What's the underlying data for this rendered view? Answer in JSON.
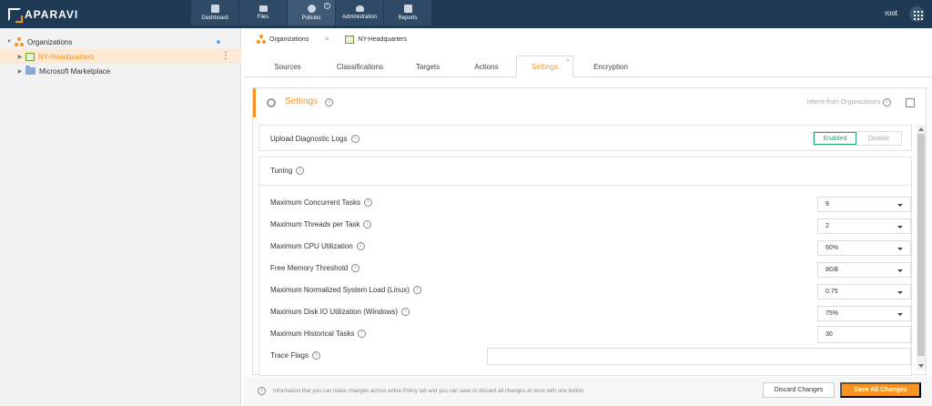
{
  "app": {
    "logo_text": "APARAVI",
    "user": "root"
  },
  "nav": [
    {
      "label": "Dashboard",
      "icon": "dashboard-icon"
    },
    {
      "label": "Files",
      "icon": "folder-icon"
    },
    {
      "label": "Policies",
      "icon": "gear-icon",
      "active": true
    },
    {
      "label": "Administration",
      "icon": "users-icon"
    },
    {
      "label": "Reports",
      "icon": "report-icon"
    }
  ],
  "tree": {
    "root": "Organizations",
    "children": [
      {
        "label": "NY-Headquarters",
        "selected": true
      },
      {
        "label": "Microsoft Marketplace"
      }
    ]
  },
  "breadcrumb": [
    "Organizations",
    "NY-Headquarters"
  ],
  "tabs": [
    "Sources",
    "Classifications",
    "Targets",
    "Actions",
    "Settings",
    "Encryption"
  ],
  "active_tab": "Settings",
  "settings": {
    "title": "Settings",
    "inherit_label": "Inherit from Organizations",
    "upload_logs": {
      "label": "Upload Diagnostic Logs",
      "enabled": "Enabled",
      "disable": "Disable"
    },
    "tuning_label": "Tuning",
    "fields": [
      {
        "label": "Maximum Concurrent Tasks",
        "value": "9"
      },
      {
        "label": "Maximum Threads per Task",
        "value": "2"
      },
      {
        "label": "Maximum CPU Utilization",
        "value": "60%"
      },
      {
        "label": "Free Memory Threshold",
        "value": "8GB"
      },
      {
        "label": "Maximum Normalized System Load (Linux)",
        "value": "0.75"
      },
      {
        "label": "Maximum Disk IO Utilization (Windows)",
        "value": "75%"
      }
    ],
    "historical": {
      "label": "Maximum Historical Tasks",
      "value": "30"
    },
    "trace": {
      "label": "Trace Flags",
      "value": ""
    }
  },
  "footer": {
    "note": "Information that you can make changes across entire Policy tab and you can save or discard all changes at once with one button",
    "discard": "Discard Changes",
    "save": "Save All Changes"
  },
  "colors": {
    "topbar": "#1e3a55",
    "accent": "#f7941d",
    "enabled": "#27a37a"
  }
}
